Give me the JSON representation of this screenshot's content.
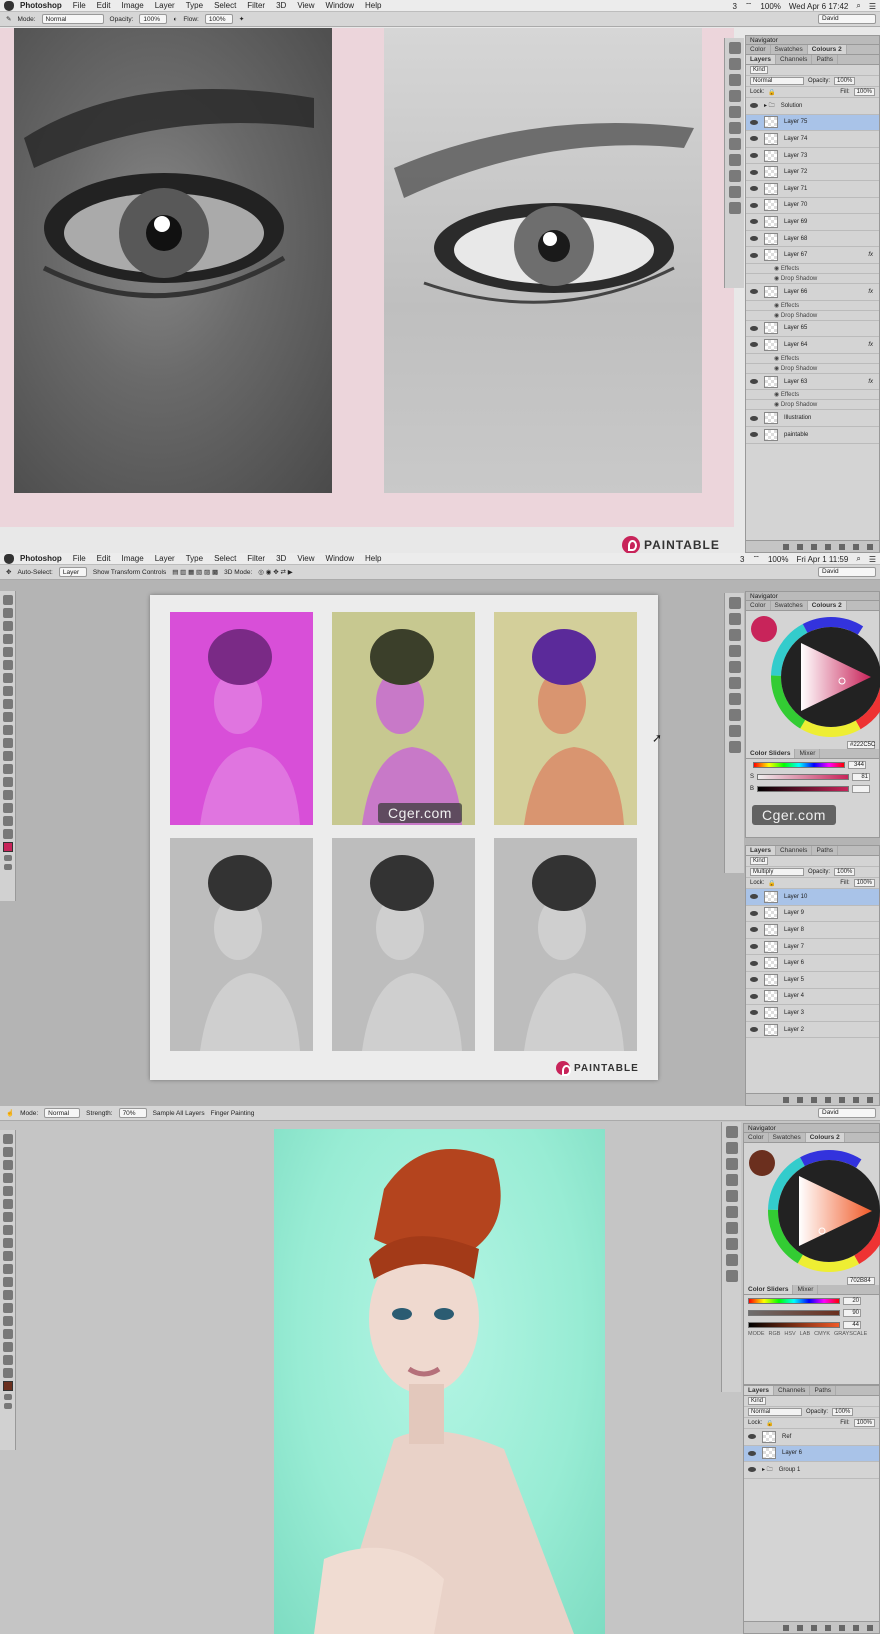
{
  "shot1": {
    "menu": [
      "Photoshop",
      "File",
      "Edit",
      "Image",
      "Layer",
      "Type",
      "Select",
      "Filter",
      "3D",
      "View",
      "Window",
      "Help"
    ],
    "status": {
      "num": "3",
      "clock": "Wed Apr 6  17:42",
      "battery": "100%"
    },
    "options": {
      "mode_label": "Mode:",
      "mode_value": "Normal",
      "opacity_label": "Opacity:",
      "opacity_value": "100%",
      "flow_label": "Flow:",
      "flow_value": "100%",
      "workspace": "David"
    },
    "panel_title": "Navigator",
    "swatch_tabs": [
      "Color",
      "Swatches",
      "Colours 2"
    ],
    "layer_tabs": [
      "Layers",
      "Channels",
      "Paths"
    ],
    "kind": "Kind",
    "blend": "Normal",
    "opacity_label": "Opacity:",
    "opacity": "100%",
    "lock_label": "Lock:",
    "fill_label": "Fill:",
    "fill": "100%",
    "fx_label": "fx",
    "layers": [
      {
        "name": "Solution",
        "type": "group"
      },
      {
        "name": "Layer 75",
        "selected": true
      },
      {
        "name": "Layer 74"
      },
      {
        "name": "Layer 73"
      },
      {
        "name": "Layer 72"
      },
      {
        "name": "Layer 71"
      },
      {
        "name": "Layer 70"
      },
      {
        "name": "Layer 69"
      },
      {
        "name": "Layer 68"
      },
      {
        "name": "Layer 67",
        "fx": true,
        "effects": [
          "Effects",
          "Drop Shadow"
        ]
      },
      {
        "name": "Layer 66",
        "fx": true,
        "effects": [
          "Effects",
          "Drop Shadow"
        ]
      },
      {
        "name": "Layer 65"
      },
      {
        "name": "Layer 64",
        "fx": true,
        "effects": [
          "Effects",
          "Drop Shadow"
        ]
      },
      {
        "name": "Layer 63",
        "fx": true,
        "effects": [
          "Effects",
          "Drop Shadow"
        ]
      },
      {
        "name": "Illustration"
      },
      {
        "name": "paintable"
      }
    ],
    "logo_text": "PAINTABLE"
  },
  "shot2": {
    "menu": [
      "Photoshop",
      "File",
      "Edit",
      "Image",
      "Layer",
      "Type",
      "Select",
      "Filter",
      "3D",
      "View",
      "Window",
      "Help"
    ],
    "status": {
      "num": "3",
      "clock": "Fri Apr 1  11:59",
      "battery": "100%"
    },
    "options": {
      "autoselect": "Auto-Select:",
      "autoselect_value": "Layer",
      "transform": "Show Transform Controls",
      "mode3d": "3D Mode:",
      "workspace": "David"
    },
    "panel_title": "Navigator",
    "swatch_tabs": [
      "Color",
      "Swatches",
      "Colours 2"
    ],
    "hex": "#222C5C",
    "slider_tabs": [
      "Color Sliders",
      "Mixer"
    ],
    "sliders": [
      {
        "label": "",
        "value": "344"
      },
      {
        "label": "S",
        "value": "81"
      },
      {
        "label": "B",
        "value": ""
      }
    ],
    "watermark": "Cger.com",
    "layer_tabs": [
      "Layers",
      "Channels",
      "Paths"
    ],
    "kind": "Kind",
    "blend": "Multiply",
    "opacity_label": "Opacity:",
    "opacity": "100%",
    "lock_label": "Lock:",
    "fill_label": "Fill:",
    "fill": "100%",
    "layers": [
      {
        "name": "Layer 10",
        "selected": true
      },
      {
        "name": "Layer 9"
      },
      {
        "name": "Layer 8"
      },
      {
        "name": "Layer 7"
      },
      {
        "name": "Layer 6"
      },
      {
        "name": "Layer 5"
      },
      {
        "name": "Layer 4"
      },
      {
        "name": "Layer 3"
      },
      {
        "name": "Layer 2"
      }
    ],
    "logo_text": "PAINTABLE"
  },
  "shot3": {
    "options": {
      "mode_label": "Mode:",
      "mode_value": "Normal",
      "strength_label": "Strength:",
      "strength_value": "70%",
      "sample": "Sample All Layers",
      "finger": "Finger Painting",
      "workspace": "David"
    },
    "panel_title": "Navigator",
    "swatch_tabs": [
      "Color",
      "Swatches",
      "Colours 2"
    ],
    "hex": "702B84",
    "slider_tabs": [
      "Color Sliders",
      "Mixer"
    ],
    "sliders": [
      {
        "value": "20"
      },
      {
        "value": "90"
      },
      {
        "value": "44"
      }
    ],
    "modes": [
      "MODE",
      "RGB",
      "HSV",
      "LAB",
      "CMYK",
      "GRAYSCALE"
    ],
    "layer_tabs": [
      "Layers",
      "Channels",
      "Paths"
    ],
    "kind": "Kind",
    "blend": "Normal",
    "opacity_label": "Opacity:",
    "opacity": "100%",
    "lock_label": "Lock:",
    "fill_label": "Fill:",
    "fill": "100%",
    "layers": [
      {
        "name": "Ref"
      },
      {
        "name": "Layer 6",
        "selected": true
      },
      {
        "name": "Group 1",
        "type": "group"
      }
    ]
  },
  "colors": {
    "accent": "#c8245a",
    "pink_bg": "#ecd5db",
    "selected_row": "#a9c3e8",
    "teal": "#9af0d8"
  }
}
